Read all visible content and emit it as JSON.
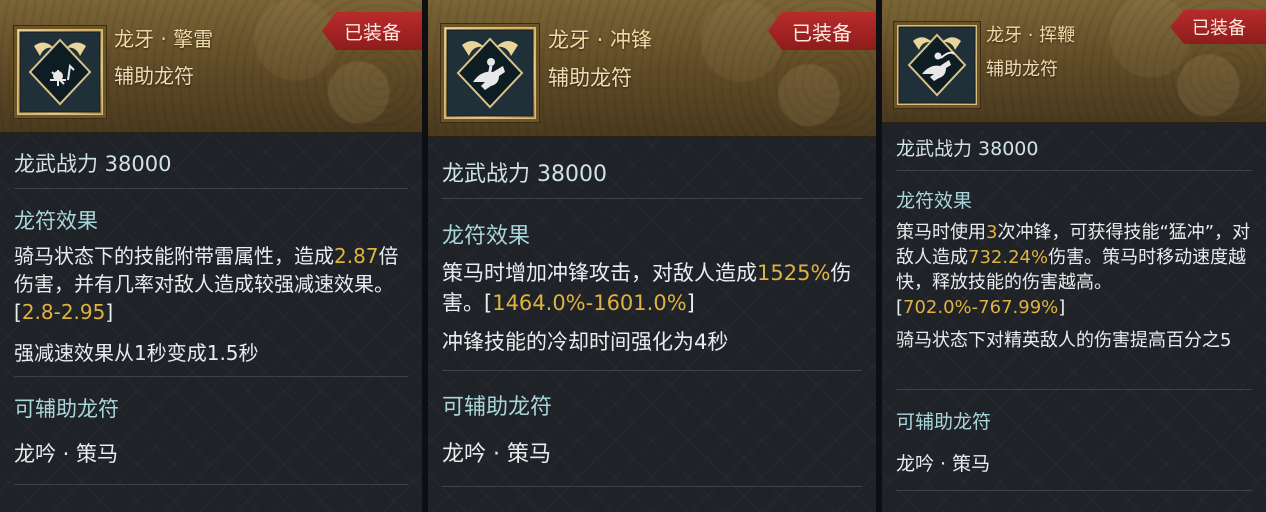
{
  "cards": [
    {
      "name": "龙牙 · 擎雷",
      "type": "辅助龙符",
      "badge": "已装备",
      "power": "龙武战力 38000",
      "effect_title": "龙符效果",
      "effect_segments": [
        {
          "t": "骑马状态下的技能附带雷属性，造成",
          "h": false
        },
        {
          "t": "2.87",
          "h": true
        },
        {
          "t": "倍伤害，并有几率对敌人造成较强减速效果。[",
          "h": false
        },
        {
          "t": "2.8-2.95",
          "h": true
        },
        {
          "t": "]",
          "h": false
        }
      ],
      "extra_line": "强减速效果从1秒变成1.5秒",
      "assist_title": "可辅助龙符",
      "assist_value": "龙吟 · 策马",
      "icon": "horse-rider-cracked-icon"
    },
    {
      "name": "龙牙 · 冲锋",
      "type": "辅助龙符",
      "badge": "已装备",
      "power": "龙武战力 38000",
      "effect_title": "龙符效果",
      "effect_segments": [
        {
          "t": "策马时增加冲锋攻击，对敌人造成",
          "h": false
        },
        {
          "t": "1525%",
          "h": true
        },
        {
          "t": "伤害。[",
          "h": false
        },
        {
          "t": "1464.0%-1601.0%",
          "h": true
        },
        {
          "t": "]",
          "h": false
        }
      ],
      "extra_line": "冲锋技能的冷却时间强化为4秒",
      "assist_title": "可辅助龙符",
      "assist_value": "龙吟 · 策马",
      "icon": "galloping-rider-icon"
    },
    {
      "name": "龙牙 · 挥鞭",
      "type": "辅助龙符",
      "badge": "已装备",
      "power": "龙武战力 38000",
      "effect_title": "龙符效果",
      "effect_segments": [
        {
          "t": "策马时使用",
          "h": false
        },
        {
          "t": "3",
          "h": true
        },
        {
          "t": "次冲锋，可获得技能“猛冲”，对敌人造成",
          "h": false
        },
        {
          "t": "732.24%",
          "h": true
        },
        {
          "t": "伤害。策马时移动速度越快，释放技能的伤害越高。[",
          "h": false
        },
        {
          "t": "702.0%-767.99%",
          "h": true
        },
        {
          "t": "]",
          "h": false
        }
      ],
      "extra_line": "骑马状态下对精英敌人的伤害提高百分之5",
      "assist_title": "可辅助龙符",
      "assist_value": "龙吟 · 策马",
      "icon": "whip-rider-icon"
    }
  ]
}
